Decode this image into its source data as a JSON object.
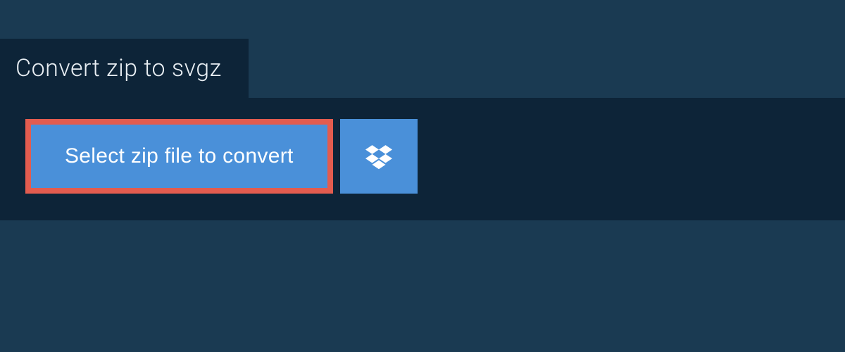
{
  "header": {
    "title": "Convert zip to svgz"
  },
  "actions": {
    "select_file_label": "Select zip file to convert",
    "dropbox_icon": "dropbox-icon"
  },
  "colors": {
    "background": "#1a3a52",
    "panel": "#0d2438",
    "button": "#4a90d9",
    "highlight_border": "#e25c4f",
    "text_light": "#e8eef3",
    "text_white": "#ffffff"
  }
}
